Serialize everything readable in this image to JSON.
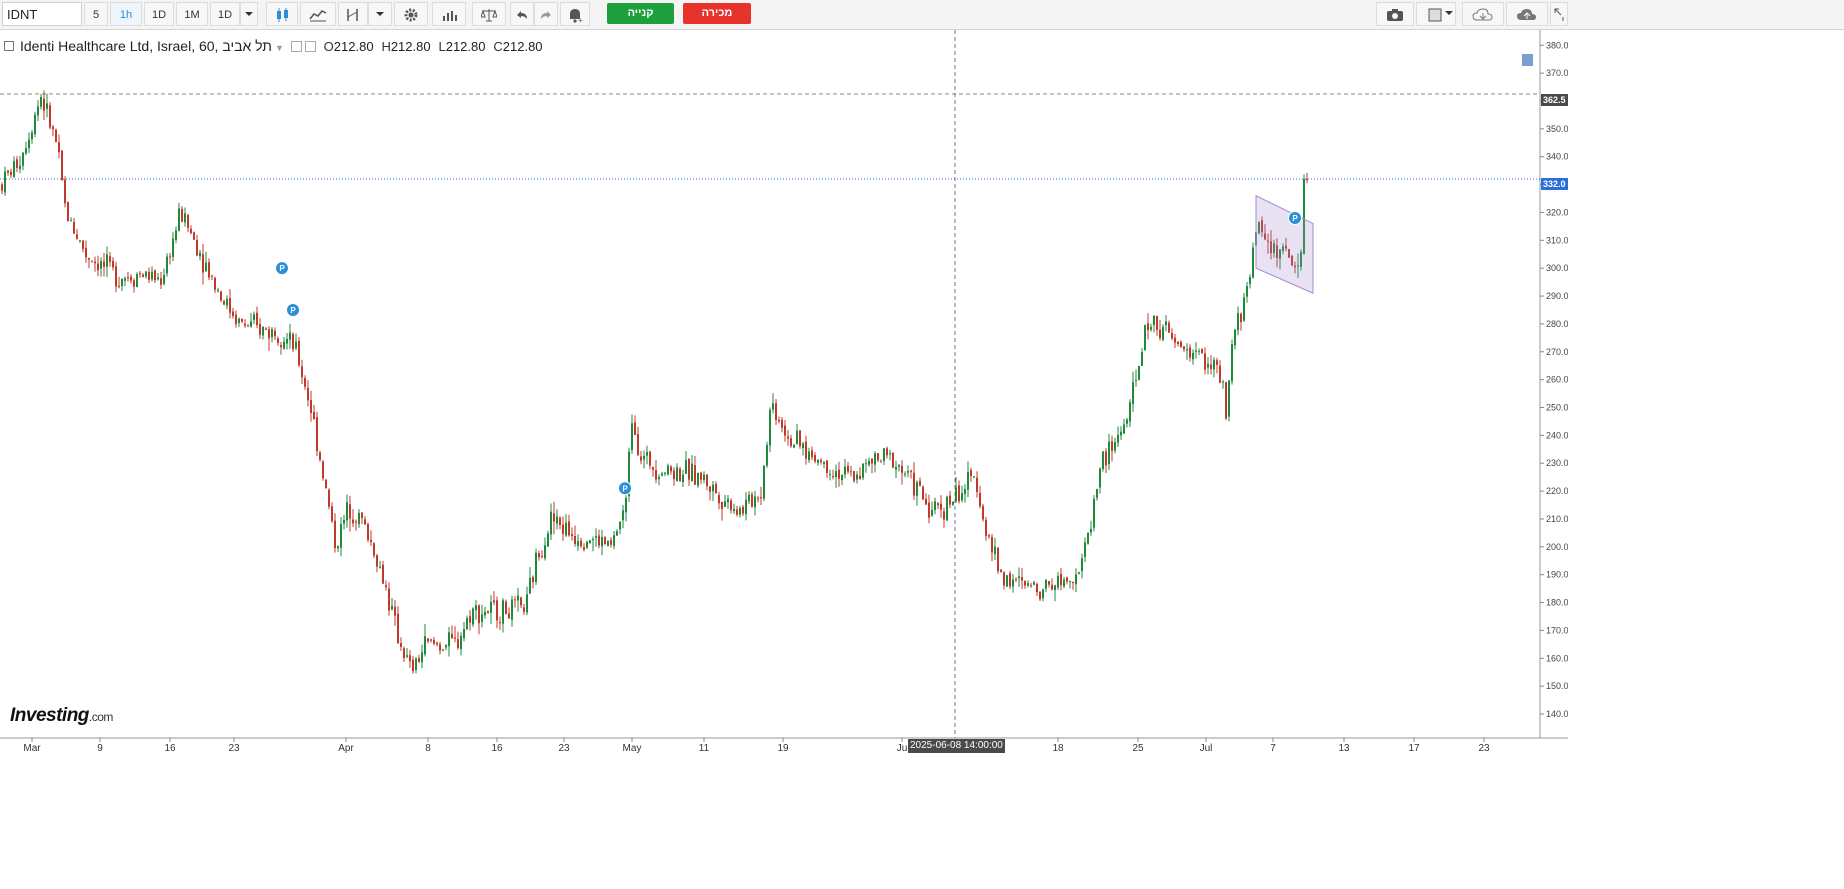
{
  "toolbar": {
    "symbol": "IDNT",
    "intervals": [
      "5",
      "1h",
      "1D",
      "1M",
      "1D"
    ],
    "active_interval": "1h",
    "buy_label": "קנייה",
    "sell_label": "מכירה"
  },
  "legend": {
    "title": "Identi Healthcare Ltd, Israel, 60, תל אביב",
    "open_label": "O",
    "open": "212.80",
    "high_label": "H",
    "high": "212.80",
    "low_label": "L",
    "low": "212.80",
    "close_label": "C",
    "close": "212.80"
  },
  "crosshair": {
    "time_label": "2025-06-08 14:00:00"
  },
  "price_labels": {
    "dashed_level": "362.5",
    "last_price": "332.0"
  },
  "logo": {
    "name": "Investing",
    "suffix": ".com"
  },
  "colors": {
    "up": "#1f8a3c",
    "down": "#c0392b",
    "accent": "#2a8fd8",
    "buy": "#20a03c",
    "sell": "#e6332b",
    "channel": "#a58bd1"
  },
  "chart_data": {
    "type": "candlestick",
    "ylim": [
      135,
      388
    ],
    "y_ticks": [
      "140.0",
      "150.0",
      "160.0",
      "170.0",
      "180.0",
      "190.0",
      "200.0",
      "210.0",
      "220.0",
      "230.0",
      "240.0",
      "250.0",
      "260.0",
      "270.0",
      "280.0",
      "290.0",
      "300.0",
      "310.0",
      "320.0",
      "330.0",
      "340.0",
      "350.0",
      "360.0",
      "370.0",
      "380.0"
    ],
    "x_ticks": [
      "Mar",
      "9",
      "16",
      "23",
      "Apr",
      "8",
      "16",
      "23",
      "May",
      "11",
      "19",
      "Ju",
      "18",
      "25",
      "Jul",
      "7",
      "13",
      "17",
      "23"
    ],
    "horizontal_lines": [
      {
        "name": "dashed_level",
        "value": 362.5,
        "style": "dashed"
      },
      {
        "name": "last_price",
        "value": 332.0,
        "style": "dotted"
      }
    ],
    "path": [
      [
        0,
        330
      ],
      [
        20,
        340
      ],
      [
        40,
        362
      ],
      [
        55,
        345
      ],
      [
        65,
        320
      ],
      [
        85,
        305
      ],
      [
        105,
        300
      ],
      [
        120,
        297
      ],
      [
        140,
        298
      ],
      [
        160,
        296
      ],
      [
        180,
        320
      ],
      [
        200,
        305
      ],
      [
        220,
        290
      ],
      [
        240,
        280
      ],
      [
        260,
        278
      ],
      [
        280,
        277
      ],
      [
        295,
        270
      ],
      [
        310,
        250
      ],
      [
        325,
        220
      ],
      [
        335,
        200
      ],
      [
        348,
        215
      ],
      [
        360,
        210
      ],
      [
        372,
        200
      ],
      [
        385,
        185
      ],
      [
        395,
        170
      ],
      [
        410,
        155
      ],
      [
        425,
        165
      ],
      [
        440,
        165
      ],
      [
        455,
        165
      ],
      [
        470,
        177
      ],
      [
        490,
        177
      ],
      [
        510,
        177
      ],
      [
        525,
        178
      ],
      [
        535,
        195
      ],
      [
        550,
        210
      ],
      [
        570,
        205
      ],
      [
        590,
        203
      ],
      [
        610,
        200
      ],
      [
        625,
        215
      ],
      [
        630,
        250
      ],
      [
        640,
        232
      ],
      [
        660,
        228
      ],
      [
        680,
        227
      ],
      [
        700,
        225
      ],
      [
        720,
        218
      ],
      [
        740,
        213
      ],
      [
        760,
        220
      ],
      [
        770,
        252
      ],
      [
        790,
        238
      ],
      [
        810,
        233
      ],
      [
        830,
        228
      ],
      [
        850,
        225
      ],
      [
        870,
        230
      ],
      [
        890,
        232
      ],
      [
        910,
        224
      ],
      [
        930,
        213
      ],
      [
        945,
        215
      ],
      [
        960,
        220
      ],
      [
        975,
        225
      ],
      [
        985,
        205
      ],
      [
        1000,
        190
      ],
      [
        1020,
        186
      ],
      [
        1040,
        186
      ],
      [
        1060,
        188
      ],
      [
        1080,
        192
      ],
      [
        1090,
        210
      ],
      [
        1100,
        230
      ],
      [
        1115,
        238
      ],
      [
        1130,
        250
      ],
      [
        1145,
        280
      ],
      [
        1160,
        280
      ],
      [
        1175,
        272
      ],
      [
        1190,
        270
      ],
      [
        1205,
        268
      ],
      [
        1220,
        260
      ],
      [
        1225,
        245
      ],
      [
        1232,
        275
      ],
      [
        1245,
        290
      ],
      [
        1255,
        315
      ],
      [
        1270,
        308
      ],
      [
        1285,
        305
      ],
      [
        1295,
        300
      ],
      [
        1300,
        305
      ],
      [
        1306,
        332
      ]
    ],
    "markers": [
      {
        "label": "P",
        "price": 300
      },
      {
        "label": "P",
        "price": 285
      },
      {
        "label": "P",
        "price": 221
      },
      {
        "label": "P",
        "price": 318
      }
    ],
    "channel": {
      "top": [
        326,
        316
      ],
      "bottom": [
        300,
        291
      ]
    }
  }
}
